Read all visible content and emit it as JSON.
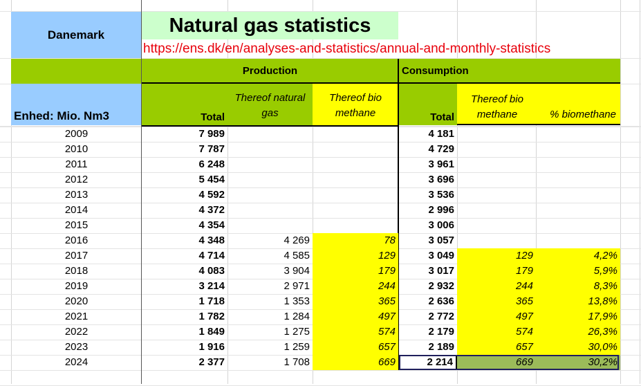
{
  "sheet": {
    "country": "Danemark",
    "title": "Natural gas statistics",
    "url": "https://ens.dk/en/analyses-and-statistics/annual-and-monthly-statistics",
    "unit_label": "Enhed: Mio. Nm3",
    "production_label": "Production",
    "consumption_label": "Consumption",
    "columns": {
      "prod_total": "Total",
      "prod_natgas": "Thereof natural gas",
      "prod_bio": "Thereof bio methane",
      "cons_total": "Total",
      "cons_bio": "Thereof bio methane",
      "cons_pct": "% biomethane"
    }
  },
  "colors": {
    "blue": "#99ccff",
    "green": "#99cc00",
    "light_green": "#ccffcc",
    "yellow": "#ffff00",
    "url_red": "#e8000b"
  },
  "rows": [
    {
      "year": "2009",
      "prod_total": "7 989",
      "prod_natgas": "",
      "prod_bio": "",
      "cons_total": "4 181",
      "cons_bio": "",
      "cons_pct": ""
    },
    {
      "year": "2010",
      "prod_total": "7 787",
      "prod_natgas": "",
      "prod_bio": "",
      "cons_total": "4 729",
      "cons_bio": "",
      "cons_pct": ""
    },
    {
      "year": "2011",
      "prod_total": "6 248",
      "prod_natgas": "",
      "prod_bio": "",
      "cons_total": "3 961",
      "cons_bio": "",
      "cons_pct": ""
    },
    {
      "year": "2012",
      "prod_total": "5 454",
      "prod_natgas": "",
      "prod_bio": "",
      "cons_total": "3 696",
      "cons_bio": "",
      "cons_pct": ""
    },
    {
      "year": "2013",
      "prod_total": "4 592",
      "prod_natgas": "",
      "prod_bio": "",
      "cons_total": "3 536",
      "cons_bio": "",
      "cons_pct": ""
    },
    {
      "year": "2014",
      "prod_total": "4 372",
      "prod_natgas": "",
      "prod_bio": "",
      "cons_total": "2 996",
      "cons_bio": "",
      "cons_pct": ""
    },
    {
      "year": "2015",
      "prod_total": "4 354",
      "prod_natgas": "",
      "prod_bio": "",
      "cons_total": "3 006",
      "cons_bio": "",
      "cons_pct": ""
    },
    {
      "year": "2016",
      "prod_total": "4 348",
      "prod_natgas": "4 269",
      "prod_bio": "78",
      "cons_total": "3 057",
      "cons_bio": "",
      "cons_pct": ""
    },
    {
      "year": "2017",
      "prod_total": "4 714",
      "prod_natgas": "4 585",
      "prod_bio": "129",
      "cons_total": "3 049",
      "cons_bio": "129",
      "cons_pct": "4,2%"
    },
    {
      "year": "2018",
      "prod_total": "4 083",
      "prod_natgas": "3 904",
      "prod_bio": "179",
      "cons_total": "3 017",
      "cons_bio": "179",
      "cons_pct": "5,9%"
    },
    {
      "year": "2019",
      "prod_total": "3 214",
      "prod_natgas": "2 971",
      "prod_bio": "244",
      "cons_total": "2 932",
      "cons_bio": "244",
      "cons_pct": "8,3%"
    },
    {
      "year": "2020",
      "prod_total": "1 718",
      "prod_natgas": "1 353",
      "prod_bio": "365",
      "cons_total": "2 636",
      "cons_bio": "365",
      "cons_pct": "13,8%"
    },
    {
      "year": "2021",
      "prod_total": "1 782",
      "prod_natgas": "1 284",
      "prod_bio": "497",
      "cons_total": "2 772",
      "cons_bio": "497",
      "cons_pct": "17,9%"
    },
    {
      "year": "2022",
      "prod_total": "1 849",
      "prod_natgas": "1 275",
      "prod_bio": "574",
      "cons_total": "2 179",
      "cons_bio": "574",
      "cons_pct": "26,3%"
    },
    {
      "year": "2023",
      "prod_total": "1 916",
      "prod_natgas": "1 259",
      "prod_bio": "657",
      "cons_total": "2 189",
      "cons_bio": "657",
      "cons_pct": "30,0%"
    },
    {
      "year": "2024",
      "prod_total": "2 377",
      "prod_natgas": "1 708",
      "prod_bio": "669",
      "cons_total": "2 214",
      "cons_bio": "669",
      "cons_pct": "30,2%"
    }
  ]
}
